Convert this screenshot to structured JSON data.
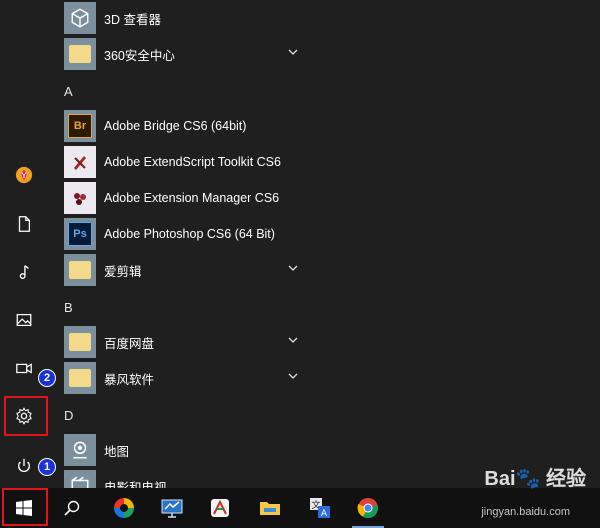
{
  "start_menu": {
    "rail": {
      "user_icon": "user-avatar-icon",
      "documents_icon": "document-icon",
      "music_icon": "music-icon",
      "pictures_icon": "pictures-icon",
      "videos_icon": "video-icon",
      "settings_icon": "gear-icon",
      "power_icon": "power-icon"
    },
    "apps": [
      {
        "label": "3D 查看器",
        "icon": "3d-viewer-icon",
        "expandable": false
      },
      {
        "label": "360安全中心",
        "icon": "folder-icon",
        "expandable": true
      },
      {
        "letter": "A"
      },
      {
        "label": "Adobe Bridge CS6 (64bit)",
        "icon": "adobe-bridge-icon",
        "tile_text": "Br",
        "expandable": false
      },
      {
        "label": "Adobe ExtendScript Toolkit CS6",
        "icon": "extendscript-icon",
        "expandable": false
      },
      {
        "label": "Adobe Extension Manager CS6",
        "icon": "extension-manager-icon",
        "expandable": false
      },
      {
        "label": "Adobe Photoshop CS6 (64 Bit)",
        "icon": "photoshop-icon",
        "tile_text": "Ps",
        "expandable": false
      },
      {
        "label": "爱剪辑",
        "icon": "folder-icon",
        "expandable": true
      },
      {
        "letter": "B"
      },
      {
        "label": "百度网盘",
        "icon": "folder-icon",
        "expandable": true
      },
      {
        "label": "暴风软件",
        "icon": "folder-icon",
        "expandable": true
      },
      {
        "letter": "D"
      },
      {
        "label": "地图",
        "icon": "maps-icon",
        "expandable": false
      },
      {
        "label": "电影和电视",
        "icon": "movies-tv-icon",
        "expandable": false
      }
    ]
  },
  "callouts": {
    "step1": "1",
    "step2": "2",
    "color": "#e1141b"
  },
  "taskbar": {
    "items": [
      {
        "name": "start-button",
        "icon": "windows-logo-icon"
      },
      {
        "name": "search-button",
        "icon": "search-icon"
      },
      {
        "name": "taskbar-app-1",
        "icon": "colorful-app-icon"
      },
      {
        "name": "taskbar-app-2",
        "icon": "monitor-app-icon"
      },
      {
        "name": "taskbar-app-3",
        "icon": "drawing-app-icon"
      },
      {
        "name": "taskbar-file-explorer",
        "icon": "folder-icon"
      },
      {
        "name": "taskbar-translator",
        "icon": "translate-icon"
      },
      {
        "name": "taskbar-chrome",
        "icon": "chrome-icon"
      }
    ]
  },
  "watermark": {
    "brand": "Bai",
    "brand2": "经验",
    "url": "jingyan.baidu.com"
  }
}
